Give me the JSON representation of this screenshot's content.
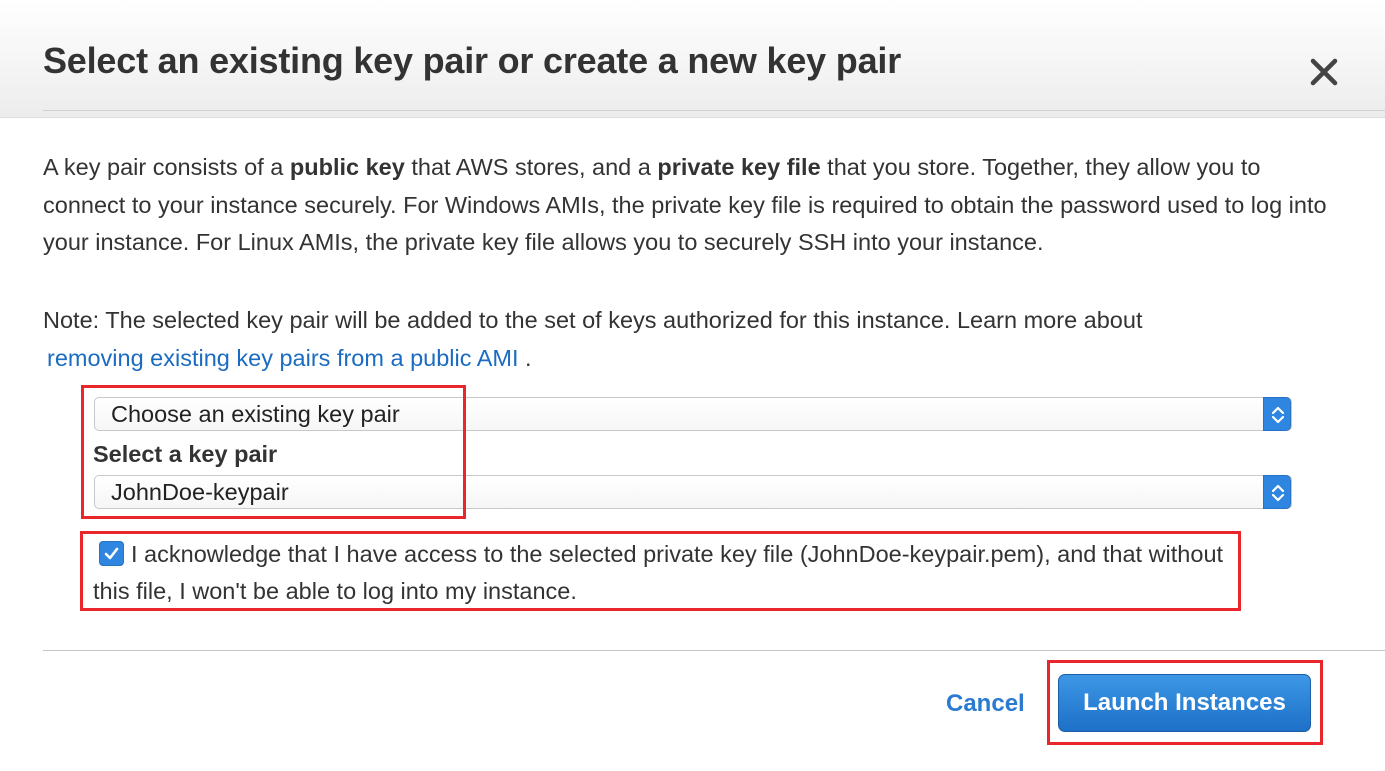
{
  "dialog": {
    "title": "Select an existing key pair or create a new key pair",
    "close_icon": "close-icon"
  },
  "description": {
    "part1": "A key pair consists of a ",
    "bold1": "public key",
    "part2": " that AWS stores, and a ",
    "bold2": "private key file",
    "part3": " that you store. Together, they allow you to connect to your instance securely. For Windows AMIs, the private key file is required to obtain the password used to log into your instance. For Linux AMIs, the private key file allows you to securely SSH into your instance."
  },
  "note": {
    "text": "Note: The selected key pair will be added to the set of keys authorized for this instance. Learn more about",
    "link": "removing existing key pairs from a public AMI",
    "suffix": " ."
  },
  "keypair_mode": {
    "selected": "Choose an existing key pair"
  },
  "keypair_select": {
    "label": "Select a key pair",
    "selected": "JohnDoe-keypair"
  },
  "acknowledge": {
    "checked": true,
    "text": "I acknowledge that I have access to the selected private key file (JohnDoe-keypair.pem), and that without this file, I won't be able to log into my instance."
  },
  "footer": {
    "cancel_label": "Cancel",
    "launch_label": "Launch Instances"
  },
  "colors": {
    "accent": "#2f86e0",
    "link": "#1a6cc2",
    "highlight": "#e8262b"
  }
}
